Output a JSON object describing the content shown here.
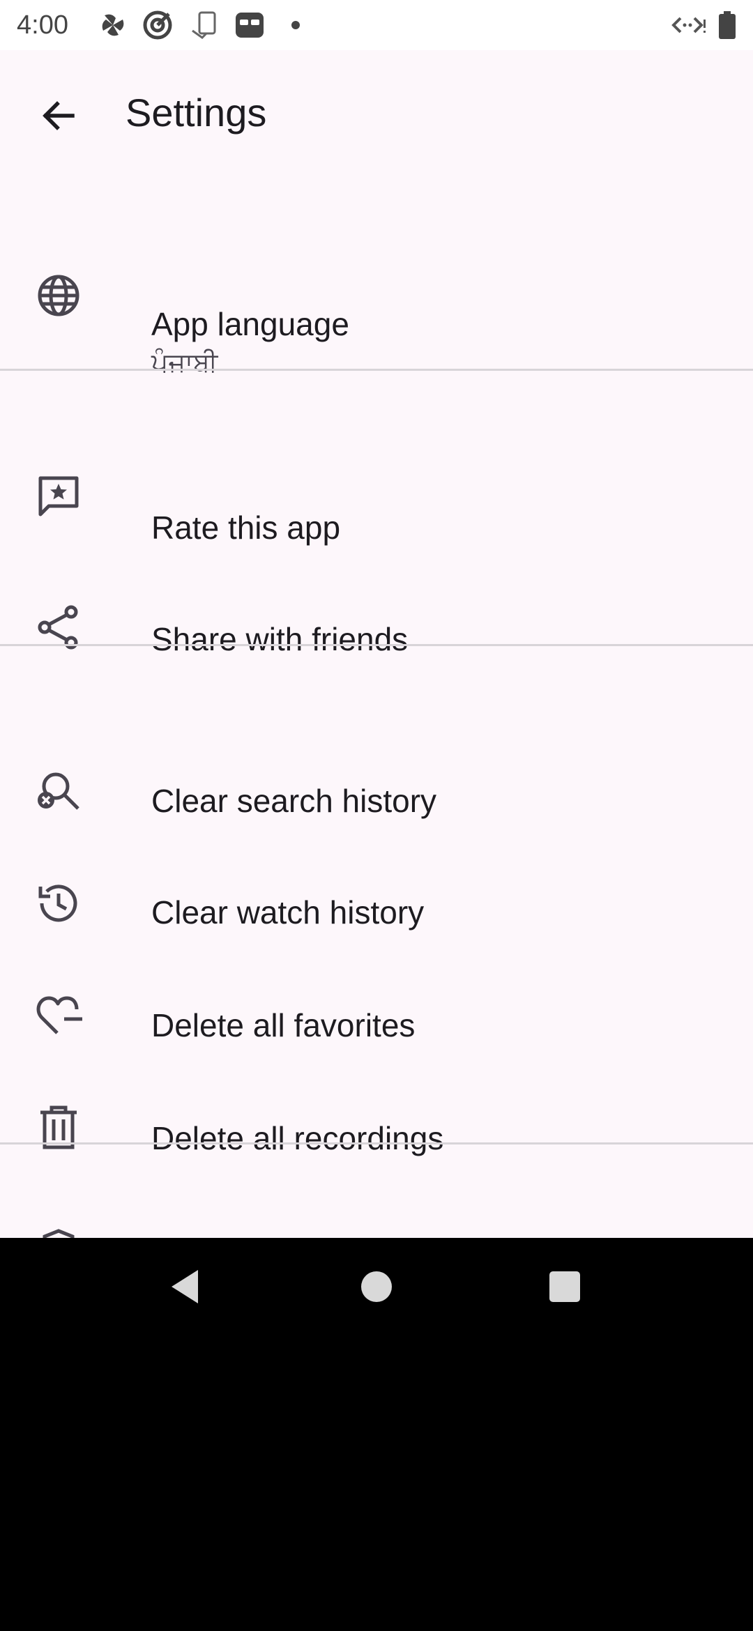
{
  "status_bar": {
    "time": "4:00",
    "icons": [
      "pinwheel-icon",
      "target-icon",
      "tablet-icon",
      "mask-icon",
      "dot-icon"
    ],
    "right_icons": [
      "data-saver-icon",
      "battery-icon"
    ]
  },
  "header": {
    "title": "Settings",
    "back_icon": "arrow-back-icon"
  },
  "settings": {
    "language": {
      "label": "App language",
      "value": "ਪੰਜਾਬੀ",
      "icon": "globe-icon"
    },
    "rate": {
      "label": "Rate this app",
      "icon": "rate-review-icon"
    },
    "share": {
      "label": "Share with friends",
      "icon": "share-icon"
    },
    "clear_search": {
      "label": "Clear search history",
      "icon": "search-off-icon"
    },
    "clear_watch": {
      "label": "Clear watch history",
      "icon": "history-icon"
    },
    "delete_favorites": {
      "label": "Delete all favorites",
      "icon": "heart-minus-icon"
    },
    "delete_recordings": {
      "label": "Delete all recordings",
      "icon": "trash-icon"
    }
  },
  "nav_bar": {
    "back": "nav-back-icon",
    "home": "nav-home-icon",
    "recents": "nav-recents-icon"
  },
  "colors": {
    "background": "#fdf7fb",
    "text_primary": "#1d1b20",
    "text_secondary": "#49454f",
    "divider": "#d8d4d8"
  }
}
